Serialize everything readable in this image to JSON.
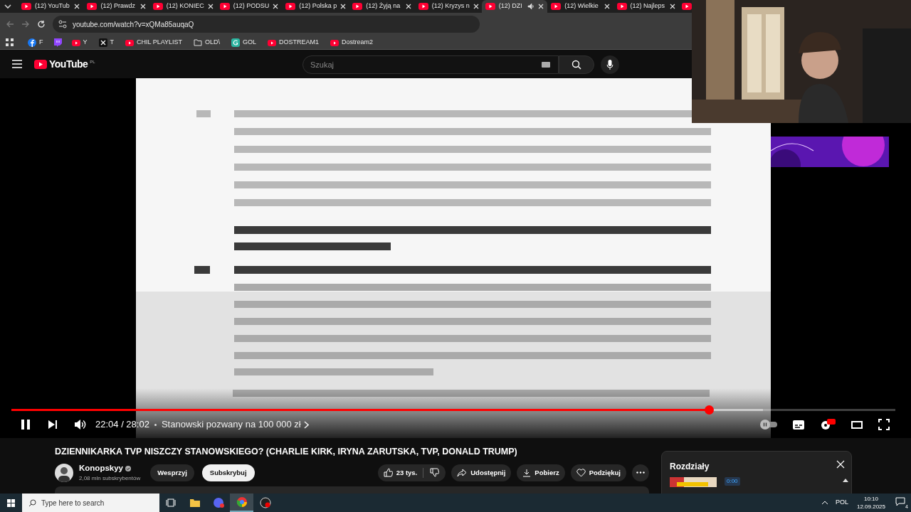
{
  "browser": {
    "tabs": [
      {
        "title": "(12) YouTub",
        "selected": false,
        "audio": false
      },
      {
        "title": "(12) Prawdz",
        "selected": false,
        "audio": false
      },
      {
        "title": "(12) KONIEC",
        "selected": false,
        "audio": false
      },
      {
        "title": "(12) PODSU",
        "selected": false,
        "audio": false
      },
      {
        "title": "(12) Polska p",
        "selected": false,
        "audio": false
      },
      {
        "title": "(12) Żyją na",
        "selected": false,
        "audio": false
      },
      {
        "title": "(12) Kryzys n",
        "selected": false,
        "audio": false
      },
      {
        "title": "(12) DZI",
        "selected": true,
        "audio": true
      },
      {
        "title": "(12) Wielkie",
        "selected": false,
        "audio": false
      },
      {
        "title": "(12) Najleps",
        "selected": false,
        "audio": false
      }
    ],
    "url": "youtube.com/watch?v=xQMa85auqaQ",
    "bookmarks": [
      {
        "kind": "facebook",
        "label": "F"
      },
      {
        "kind": "twitch"
      },
      {
        "kind": "youtube",
        "label": "Y"
      },
      {
        "kind": "x",
        "label": "T"
      },
      {
        "kind": "youtube",
        "label": "CHIL PLAYLIST"
      },
      {
        "kind": "folder",
        "label": "OLD\\"
      },
      {
        "kind": "gol",
        "label": "GOL"
      },
      {
        "kind": "youtube",
        "label": "DOSTREAM1"
      },
      {
        "kind": "youtube",
        "label": "Dostream2"
      }
    ]
  },
  "youtube": {
    "logo": "YouTube",
    "region": "PL",
    "search": {
      "placeholder": "Szukaj"
    }
  },
  "player": {
    "progress": {
      "level": 0.789
    },
    "time": "22:04 / 28:02",
    "chapter": "Stanowski pozwany na 100 000 zł",
    "playing": true
  },
  "video": {
    "title": "DZIENNIKARKA TVP NISZCZY STANOWSKIEGO? (CHARLIE KIRK, IRYNA ZARUTSKA, TVP, DONALD TRUMP)",
    "channel": "Konopskyy",
    "verified": true,
    "subscribers": "2,08 mln subskrybentów",
    "support": "Wesprzyj",
    "subscribe": "Subskrybuj",
    "likes": "23 tys.",
    "share": "Udostępnij",
    "download": "Pobierz",
    "thanks": "Podziękuj"
  },
  "chapters": {
    "title": "Rozdziały",
    "first_time": "0:00"
  },
  "taskbar": {
    "search": {
      "placeholder": "Type here to search"
    },
    "language": "POL",
    "time": "10:10",
    "date": "12.09.2025",
    "notifications": "4"
  }
}
